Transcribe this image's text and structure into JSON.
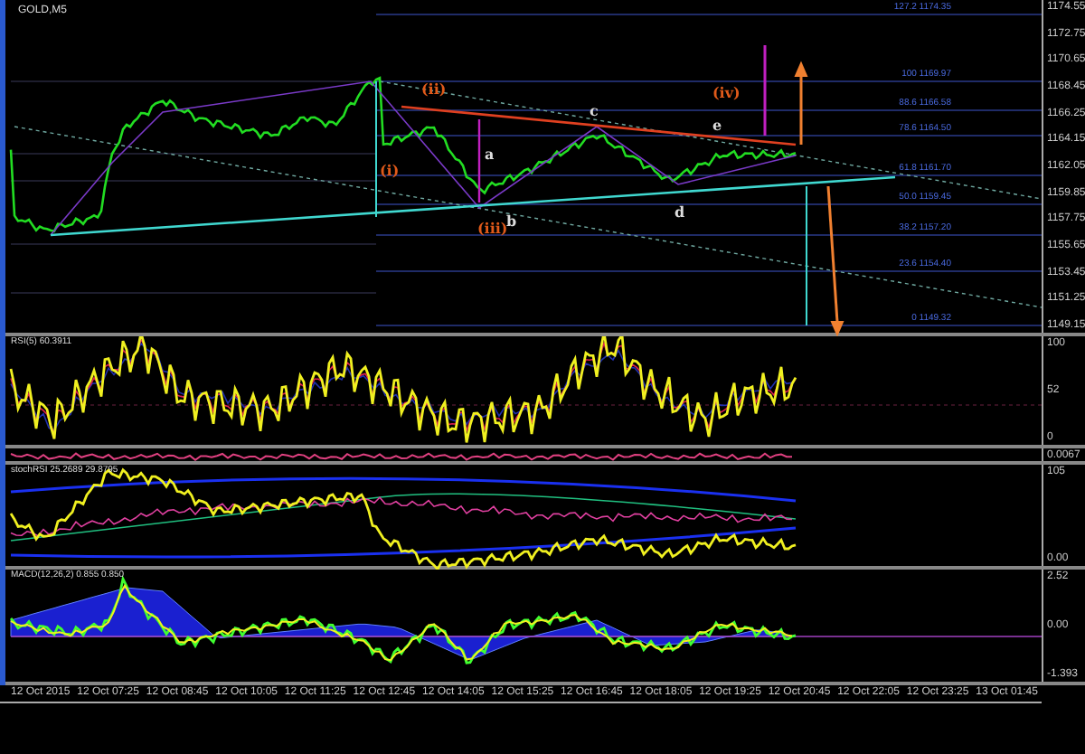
{
  "chart": {
    "symbol": "GOLD,M5",
    "price_axis": [
      "1174.55",
      "1172.75",
      "1170.65",
      "1168.45",
      "1166.25",
      "1164.15",
      "1162.05",
      "1159.85",
      "1157.75",
      "1155.65",
      "1153.45",
      "1151.25",
      "1149.15"
    ],
    "fib_levels": [
      {
        "label": "127.2 1174.35"
      },
      {
        "label": "100 1169.97"
      },
      {
        "label": "88.6 1166.58"
      },
      {
        "label": "78.6 1164.50"
      },
      {
        "label": "61.8 1161.70"
      },
      {
        "label": "50.0 1159.45"
      },
      {
        "label": "38.2 1157.20"
      },
      {
        "label": "23.6 1154.40"
      },
      {
        "label": "0 1149.32"
      }
    ],
    "wave_labels": [
      {
        "text": "(ii)",
        "color": "#e05a1a"
      },
      {
        "text": "(i)",
        "color": "#e05a1a"
      },
      {
        "text": "(iii)",
        "color": "#e05a1a"
      },
      {
        "text": "(iv)",
        "color": "#e05a1a"
      },
      {
        "text": "a",
        "color": "#dddddd"
      },
      {
        "text": "b",
        "color": "#dddddd"
      },
      {
        "text": "c",
        "color": "#dddddd"
      },
      {
        "text": "d",
        "color": "#dddddd"
      },
      {
        "text": "e",
        "color": "#dddddd"
      }
    ]
  },
  "indicators": [
    {
      "kind": "rsi",
      "label": "RSI(5) 60.3911",
      "axis": [
        "100",
        "52",
        "0"
      ]
    },
    {
      "kind": "strip",
      "axis": [
        "0.0067"
      ]
    },
    {
      "kind": "stoch",
      "label": "stochRSI 25.2689 29.8795",
      "axis": [
        "105",
        "0.00"
      ]
    },
    {
      "kind": "macd",
      "label": "MACD(12,26,2) 0.855 0.850",
      "axis": [
        "2.52",
        "0.00",
        "-1.393"
      ]
    }
  ],
  "time_axis": [
    "12 Oct 2015",
    "12 Oct 07:25",
    "12 Oct 08:45",
    "12 Oct 10:05",
    "12 Oct 11:25",
    "12 Oct 12:45",
    "12 Oct 14:05",
    "12 Oct 15:25",
    "12 Oct 16:45",
    "12 Oct 18:05",
    "12 Oct 19:25",
    "12 Oct 20:45",
    "12 Oct 22:05",
    "12 Oct 23:25",
    "13 Oct 01:45"
  ]
}
